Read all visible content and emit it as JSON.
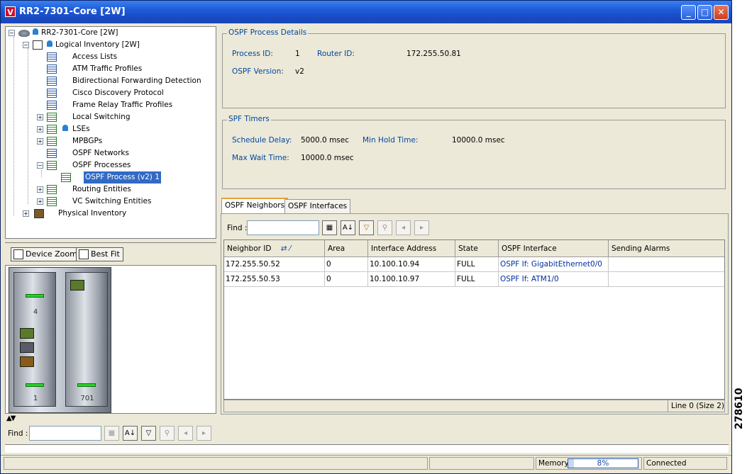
{
  "window": {
    "title": "RR2-7301-Core [2W]",
    "app_icon_glyph": "V",
    "controls": {
      "minimize": "_",
      "maximize": "□",
      "close": "✕"
    }
  },
  "tree": {
    "root": "RR2-7301-Core [2W]",
    "logical": "Logical Inventory [2W]",
    "items": [
      "Access Lists",
      "ATM Traffic Profiles",
      "Bidirectional Forwarding Detection",
      "Cisco Discovery Protocol",
      "Frame Relay Traffic Profiles",
      "Local Switching",
      "LSEs",
      "MPBGPs",
      "OSPF Networks",
      "OSPF Processes",
      "OSPF Process (v2) 1",
      "Routing Entities",
      "VC Switching Entities"
    ],
    "physical": "Physical Inventory",
    "expander_plus": "+",
    "expander_minus": "−"
  },
  "zoom": {
    "device_zoom": "Device Zoom",
    "best_fit": "Best Fit"
  },
  "rack": {
    "card_left_top": "4",
    "card_left_bottom": "1",
    "card_right_bottom": "701"
  },
  "split_arrows": "▲▼",
  "process_details": {
    "title": "OSPF Process Details",
    "process_id_label": "Process ID:",
    "process_id": "1",
    "router_id_label": "Router ID:",
    "router_id": "172.255.50.81",
    "version_label": "OSPF Version:",
    "version": "v2"
  },
  "spf_timers": {
    "title": "SPF Timers",
    "schedule_delay_label": "Schedule Delay:",
    "schedule_delay": "5000.0 msec",
    "min_hold_label": "Min Hold Time:",
    "min_hold": "10000.0 msec",
    "max_wait_label": "Max Wait Time:",
    "max_wait": "10000.0 msec"
  },
  "tabs": [
    "OSPF Neighbors",
    "OSPF Interfaces"
  ],
  "find": {
    "label": "Find :",
    "value": ""
  },
  "toolbar_icons": {
    "save": "▦",
    "sort": "A↓",
    "filter": "▽",
    "clear": "⚲",
    "prev": "◂",
    "next": "▸"
  },
  "table": {
    "headers": [
      "Neighbor ID",
      "Area",
      "Interface Address",
      "State",
      "OSPF Interface",
      "Sending Alarms"
    ],
    "sort_glyph": "⇄ ⁄",
    "rows": [
      [
        "172.255.50.52",
        "0",
        "10.100.10.94",
        "FULL",
        "OSPF If: GigabitEthernet0/0",
        ""
      ],
      [
        "172.255.50.53",
        "0",
        "10.100.10.97",
        "FULL",
        "OSPF If: ATM1/0",
        ""
      ]
    ],
    "status": "Line 0 (Size 2)"
  },
  "bottom_find": {
    "label": "Find :",
    "value": ""
  },
  "statusbar": {
    "memory_label": "Memory:",
    "memory_value": "8%",
    "memory_fraction": 0.08,
    "connection": "Connected"
  },
  "figure_number": "278610"
}
